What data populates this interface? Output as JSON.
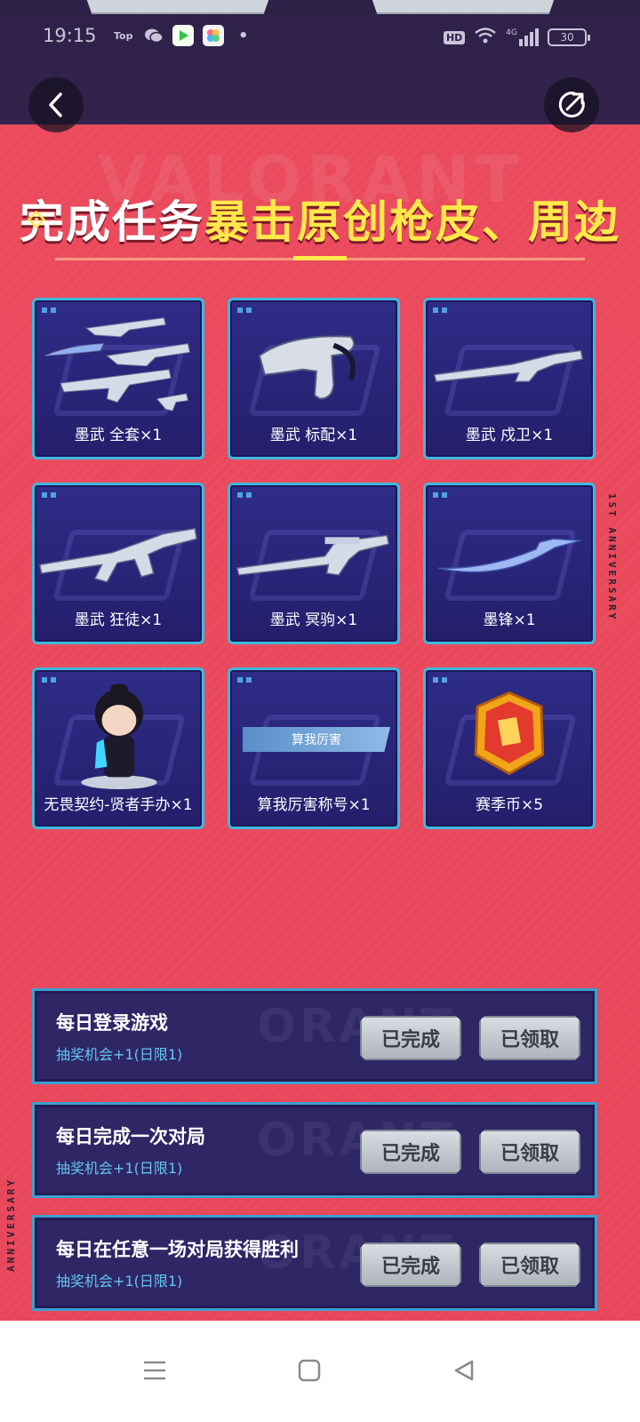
{
  "status_bar": {
    "time": "19:15",
    "app_icons": [
      "Top",
      "wechat-icon",
      "video-app-icon",
      "photo-app-icon"
    ],
    "hd": "HD",
    "network": "4G",
    "battery": "30"
  },
  "header": {
    "back_icon": "chevron-left-icon",
    "share_icon": "share-icon"
  },
  "banner": {
    "title_part1": "完成任务",
    "title_part2": "暴击原创枪皮、周边"
  },
  "side_labels": {
    "right": "1ST ANNIVERSARY",
    "left": "ANNIVERSARY"
  },
  "rewards": [
    {
      "label": "墨武 全套×1",
      "art": "weapon-set"
    },
    {
      "label": "墨武 标配×1",
      "art": "pistol"
    },
    {
      "label": "墨武 戍卫×1",
      "art": "rifle"
    },
    {
      "label": "墨武 狂徒×1",
      "art": "rifle-ak"
    },
    {
      "label": "墨武 冥驹×1",
      "art": "sniper"
    },
    {
      "label": "墨锋×1",
      "art": "blade"
    },
    {
      "label": "无畏契约-贤者手办×1",
      "art": "figure"
    },
    {
      "label": "算我厉害称号×1",
      "art": "title-chip",
      "chip_text": "算我厉害"
    },
    {
      "label": "赛季币×5",
      "art": "coin"
    }
  ],
  "tasks": [
    {
      "title": "每日登录游戏",
      "subtitle": "抽奖机会+1(日限1)",
      "done_label": "已完成",
      "claim_label": "已领取"
    },
    {
      "title": "每日完成一次对局",
      "subtitle": "抽奖机会+1(日限1)",
      "done_label": "已完成",
      "claim_label": "已领取"
    },
    {
      "title": "每日在任意一场对局获得胜利",
      "subtitle": "抽奖机会+1(日限1)",
      "done_label": "已完成",
      "claim_label": "已领取"
    }
  ],
  "nav": {
    "items": [
      "menu-icon",
      "home-icon",
      "back-icon"
    ]
  },
  "colors": {
    "page_red": "#e8485a",
    "card_navy": "#2a2679",
    "card_border": "#3fb9de",
    "title_yellow": "#ffe84a",
    "task_sub_blue": "#63c6f0"
  }
}
